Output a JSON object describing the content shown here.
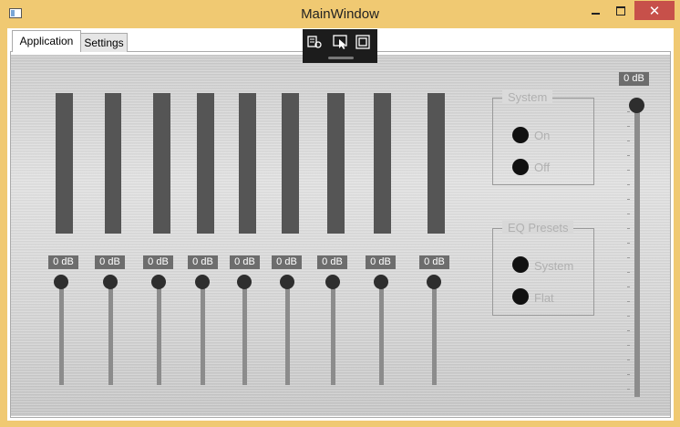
{
  "window": {
    "title": "MainWindow",
    "close_glyph": "✕"
  },
  "tabs": [
    {
      "label": "Application"
    },
    {
      "label": "Settings"
    }
  ],
  "overlay_toolbar": {
    "icons": [
      "live-visual-tree-icon",
      "select-element-icon",
      "display-layout-adorners-icon"
    ]
  },
  "equalizer": {
    "bands": [
      {
        "level": "0 dB"
      },
      {
        "level": "0 dB"
      },
      {
        "level": "0 dB"
      },
      {
        "level": "0 dB"
      },
      {
        "level": "0 dB"
      },
      {
        "level": "0 dB"
      },
      {
        "level": "0 dB"
      },
      {
        "level": "0 dB"
      },
      {
        "level": "0 dB"
      }
    ],
    "master": {
      "level": "0 dB"
    }
  },
  "system_group": {
    "title": "System",
    "options": [
      {
        "label": "On"
      },
      {
        "label": "Off"
      }
    ]
  },
  "presets_group": {
    "title": "EQ Presets",
    "options": [
      {
        "label": "System"
      },
      {
        "label": "Flat"
      }
    ]
  },
  "colors": {
    "titlebar": "#f0c972",
    "close_button": "#c7504a",
    "meter": "#555555"
  }
}
